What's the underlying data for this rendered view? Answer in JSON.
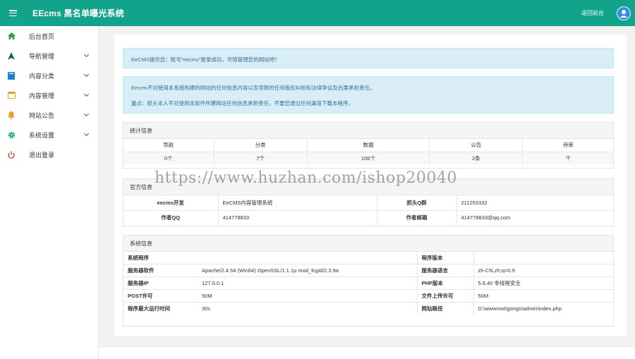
{
  "header": {
    "title": "EEcms 黑名单曝光系统",
    "back_link": "返回前台"
  },
  "sidebar": {
    "items": [
      {
        "label": "后台首页",
        "icon": "home-icon",
        "color": "#2e9d3c",
        "has_submenu": false
      },
      {
        "label": "导航管理",
        "icon": "navigation-arrow-icon",
        "color": "#1a5e50",
        "has_submenu": true
      },
      {
        "label": "内容分类",
        "icon": "book-icon",
        "color": "#1f7fd0",
        "has_submenu": true
      },
      {
        "label": "内容管理",
        "icon": "window-icon",
        "color": "#f0a020",
        "has_submenu": true
      },
      {
        "label": "网站公告",
        "icon": "bell-icon",
        "color": "#f0a020",
        "has_submenu": true
      },
      {
        "label": "系统设置",
        "icon": "gear-icon",
        "color": "#13a38a",
        "has_submenu": true
      },
      {
        "label": "退出登录",
        "icon": "power-icon",
        "color": "#e03c3c",
        "has_submenu": false
      }
    ]
  },
  "alerts": {
    "welcome": "EeCMS提示您：账号\"eecms\"登录成功，尽情管理您的网站吧！",
    "disclaimer_1": "Eecms不对使用本系统构建的网站的任何信息内容以及导致的任何版权纠纷和法律争议及后果承担责任。",
    "disclaimer_2": "重点：抓头本人不对使用本软件所建网站任何信息承担责任，不要您通过任何渠道下载本程序。"
  },
  "stats": {
    "title": "统计信息",
    "headers": [
      "导航",
      "分类",
      "数据",
      "公告",
      "待审"
    ],
    "values": [
      "0个",
      "7个",
      "106个",
      "2条",
      "个"
    ]
  },
  "official": {
    "title": "官方信息",
    "rows": [
      {
        "k1": "eecms开发",
        "v1": "EeCMS内容管理系统",
        "k2": "抓头Q群",
        "v2": "211253332"
      },
      {
        "k1": "作者QQ",
        "v1": "414778833",
        "k2": "作者邮箱",
        "v2": "414778833@qq.com"
      }
    ]
  },
  "system": {
    "title": "系统信息",
    "rows": [
      {
        "k1": "系统程序",
        "v1": "",
        "k2": "程序版本",
        "v2": ""
      },
      {
        "k1": "服务器软件",
        "v1": "Apache/2.4.54 (Win64) OpenSSL/1.1.1p mod_fcgid/2.3.9a",
        "k2": "服务器语言",
        "v2": "zh-CN,zh;q=0.9"
      },
      {
        "k1": "服务器IP",
        "v1": "127.0.0.1",
        "k2": "PHP版本",
        "v2": "5.6.40 非线程安全"
      },
      {
        "k1": "POST许可",
        "v1": "50M",
        "k2": "文件上传许可",
        "v2": "50M"
      },
      {
        "k1": "程序最大运行时间",
        "v1": "30s",
        "k2": "网站路径",
        "v2": "D:\\wwwroot\\gongs\\admin\\index.php"
      }
    ]
  },
  "watermark": "https://www.huzhan.com/ishop20040",
  "colors": {
    "primary": "#13a38a",
    "alert_bg": "#d9edf7",
    "alert_text": "#31708f"
  }
}
